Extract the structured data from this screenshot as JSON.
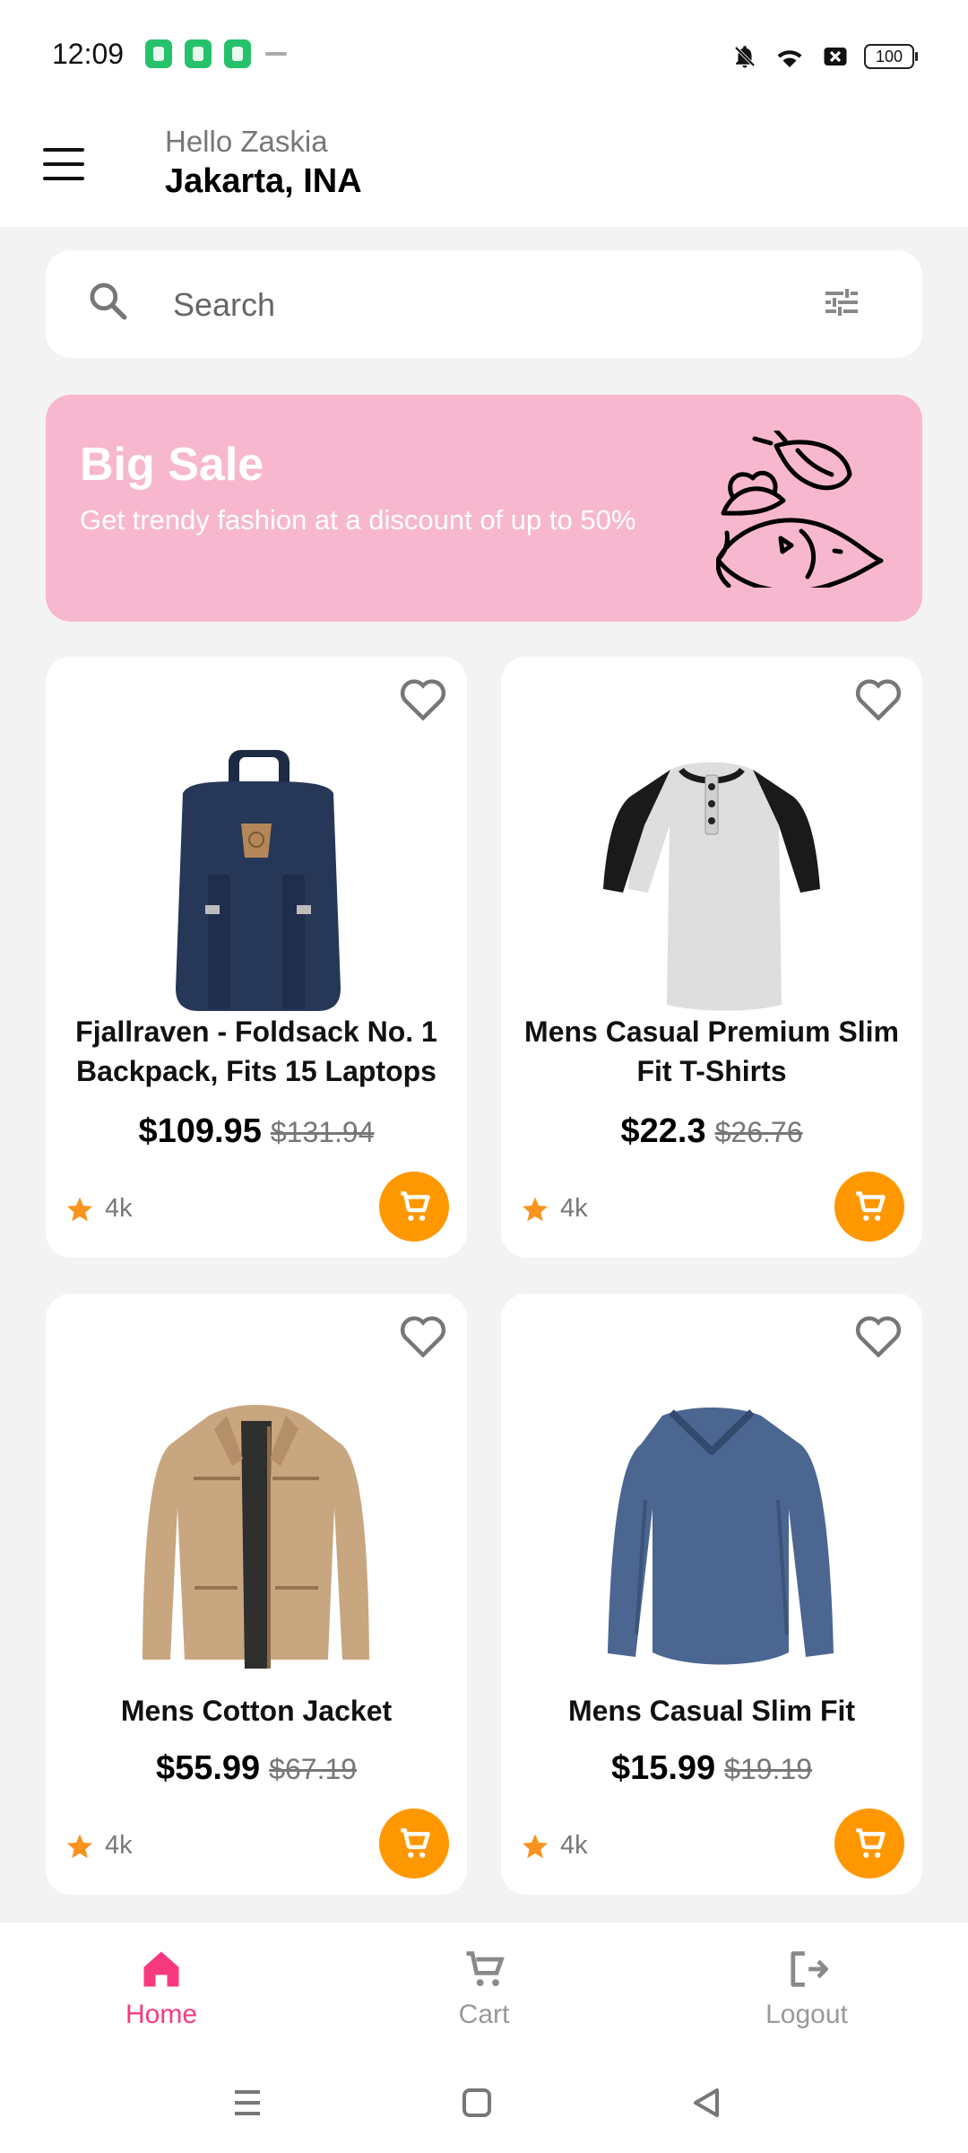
{
  "status": {
    "time": "12:09",
    "battery": "100"
  },
  "header": {
    "greeting": "Hello Zaskia",
    "location": "Jakarta, INA"
  },
  "search": {
    "placeholder": "Search"
  },
  "banner": {
    "title": "Big Sale",
    "subtitle": "Get trendy fashion at a discount of up to 50%"
  },
  "products": [
    {
      "title": "Fjallraven - Foldsack No. 1 Backpack, Fits 15 Laptops",
      "price": "$109.95",
      "old_price": "$131.94",
      "rating": "4k"
    },
    {
      "title": "Mens Casual Premium Slim Fit T-Shirts",
      "price": "$22.3",
      "old_price": "$26.76",
      "rating": "4k"
    },
    {
      "title": "Mens Cotton Jacket",
      "price": "$55.99",
      "old_price": "$67.19",
      "rating": "4k"
    },
    {
      "title": "Mens Casual Slim Fit",
      "price": "$15.99",
      "old_price": "$19.19",
      "rating": "4k"
    }
  ],
  "nav": {
    "home": "Home",
    "cart": "Cart",
    "logout": "Logout"
  },
  "colors": {
    "accent": "#f73a80",
    "cart_button": "#ff9800",
    "banner": "#f7b8cf"
  }
}
